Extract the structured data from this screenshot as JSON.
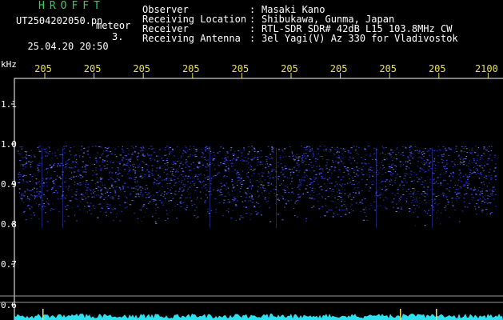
{
  "header": {
    "app_title": "HROFFT",
    "filename": "UT2504202050.pn",
    "meteor_label": "meteor",
    "date": "25.04.20",
    "time": "20:50",
    "counter": "3."
  },
  "info": [
    {
      "label": "Observer",
      "sep": ":",
      "value": "Masaki Kano"
    },
    {
      "label": "Receiving Location",
      "sep": ":",
      "value": "Shibukawa, Gunma, Japan"
    },
    {
      "label": "Receiver",
      "sep": ":",
      "value": "RTL-SDR SDR# 42dB L15 103.8MHz CW"
    },
    {
      "label": "Receiving Antenna",
      "sep": ":",
      "value": "3el Yagi(V) Az 330 for Vladivostok"
    }
  ],
  "axes": {
    "y_unit": "kHz",
    "y_ticks": [
      "1.1",
      "1.0",
      "0.9",
      "0.8",
      "0.7",
      "0.6"
    ],
    "x_ticks": [
      "205",
      "205",
      "205",
      "205",
      "205",
      "205",
      "205",
      "205",
      "205",
      "2100"
    ]
  },
  "colors": {
    "text_green": "#2fd15a",
    "text_yellow": "#e8e04a",
    "signal_blue": "#2a36d8",
    "noise_cyan": "#2de0f0"
  }
}
